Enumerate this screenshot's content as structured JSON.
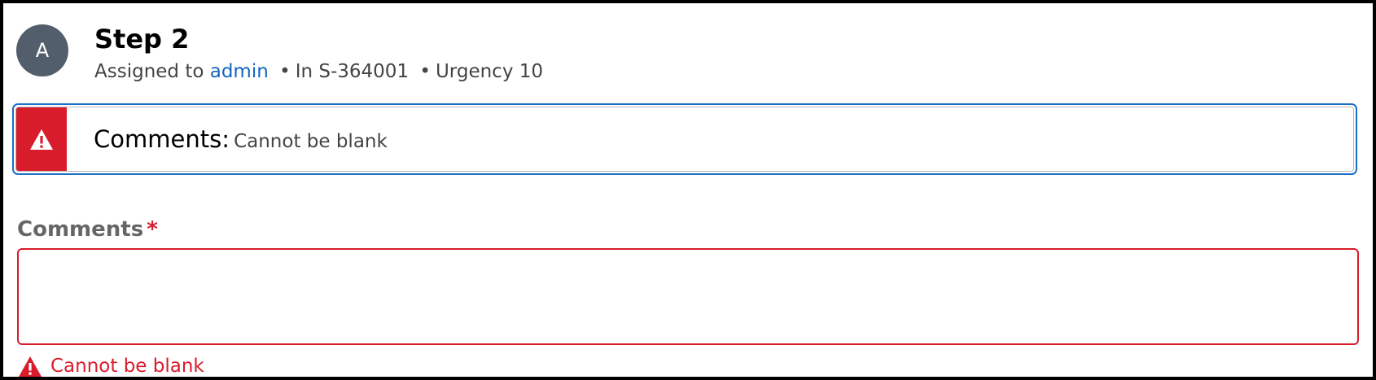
{
  "header": {
    "avatar_initial": "A",
    "title": "Step 2",
    "assigned_prefix": "Assigned to",
    "assignee": "admin",
    "separator": "•",
    "case_ref": "In S-364001",
    "urgency": "Urgency 10"
  },
  "banner": {
    "field": "Comments:",
    "message": "Cannot be blank",
    "icon": "warning-triangle-icon"
  },
  "comments_field": {
    "label": "Comments",
    "required_marker": "*",
    "value": "",
    "error": "Cannot be blank",
    "error_icon": "warning-triangle-icon"
  },
  "colors": {
    "error": "#d91c2b",
    "link": "#1365c0",
    "focus_outline": "#1a6fc6",
    "avatar_bg": "#525e6b"
  }
}
